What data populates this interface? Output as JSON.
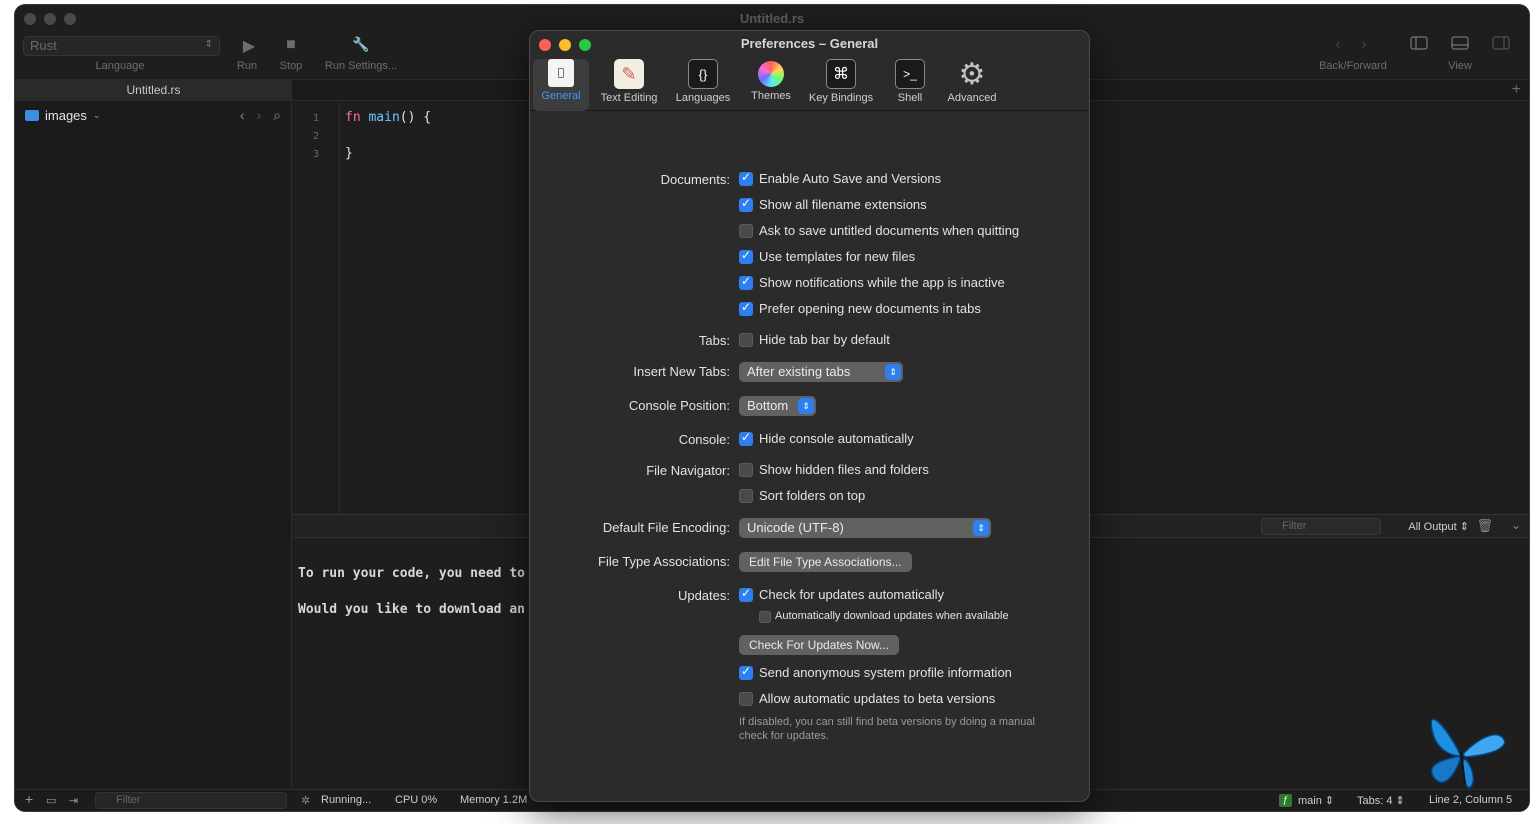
{
  "window": {
    "title": "Untitled.rs"
  },
  "toolbar": {
    "language": "Rust",
    "language_label": "Language",
    "run": "Run",
    "stop": "Stop",
    "run_settings": "Run Settings...",
    "back_forward": "Back/Forward",
    "view": "View"
  },
  "tabs": [
    {
      "label": "Untitled.rs"
    }
  ],
  "sidebar": {
    "folder": "images"
  },
  "editor": {
    "line_numbers": [
      "1",
      "2",
      "3"
    ],
    "lines": [
      {
        "kw": "fn",
        "fn": "main",
        "rest": "() {"
      },
      {
        "text": ""
      },
      {
        "text": "}"
      }
    ]
  },
  "console": {
    "filter_placeholder": "Filter",
    "output_selector": "All Output",
    "lines": [
      "To run your code, you need to",
      "Would you like to download an"
    ]
  },
  "status": {
    "filter_placeholder": "Filter",
    "running": "Running...",
    "cpu": "CPU 0%",
    "memory": "Memory 1.2M",
    "branch": "main",
    "tabs": "Tabs: 4",
    "position": "Line 2, Column 5"
  },
  "prefs": {
    "title": "Preferences – General",
    "tabs": [
      "General",
      "Text Editing",
      "Languages",
      "Themes",
      "Key Bindings",
      "Shell",
      "Advanced"
    ],
    "documents_label": "Documents:",
    "documents": [
      {
        "label": "Enable Auto Save and Versions",
        "checked": true
      },
      {
        "label": "Show all filename extensions",
        "checked": true
      },
      {
        "label": "Ask to save untitled documents when quitting",
        "checked": false
      },
      {
        "label": "Use templates for new files",
        "checked": true
      },
      {
        "label": "Show notifications while the app is inactive",
        "checked": true
      },
      {
        "label": "Prefer opening new documents in tabs",
        "checked": true
      }
    ],
    "tabs_label": "Tabs:",
    "hide_tab_bar": "Hide tab bar by default",
    "insert_new_tabs_label": "Insert New Tabs:",
    "insert_new_tabs_value": "After existing tabs",
    "console_position_label": "Console Position:",
    "console_position_value": "Bottom",
    "console_label": "Console:",
    "hide_console": "Hide console automatically",
    "file_navigator_label": "File Navigator:",
    "show_hidden": "Show hidden files and folders",
    "sort_folders": "Sort folders on top",
    "encoding_label": "Default File Encoding:",
    "encoding_value": "Unicode (UTF-8)",
    "assoc_label": "File Type Associations:",
    "assoc_button": "Edit File Type Associations...",
    "updates_label": "Updates:",
    "check_updates": "Check for updates automatically",
    "auto_download": "Automatically download updates when available",
    "check_now": "Check For Updates Now...",
    "send_profile": "Send anonymous system profile information",
    "beta_updates": "Allow automatic updates to beta versions",
    "beta_note": "If disabled, you can still find beta versions by doing a manual check for updates."
  },
  "colors": {
    "accent": "#2f7ff0",
    "background": "#1e1e1e",
    "panel": "#2b2b2b"
  }
}
